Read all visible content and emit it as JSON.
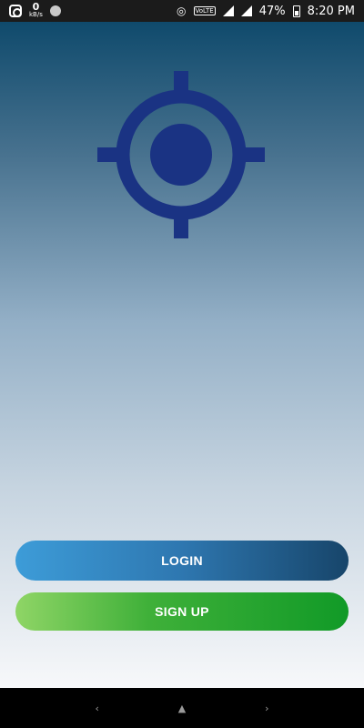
{
  "status_bar": {
    "net_speed": "0",
    "net_speed_unit": "kB/s",
    "volte": "VoLTE",
    "battery": "47%",
    "time": "8:20 PM"
  },
  "logo": {
    "icon": "location-target-icon",
    "color": "#1a3383"
  },
  "buttons": {
    "login": "LOGIN",
    "signup": "SIGN UP"
  },
  "nav": {
    "back": "‹",
    "home": "▲",
    "recents": "›"
  }
}
